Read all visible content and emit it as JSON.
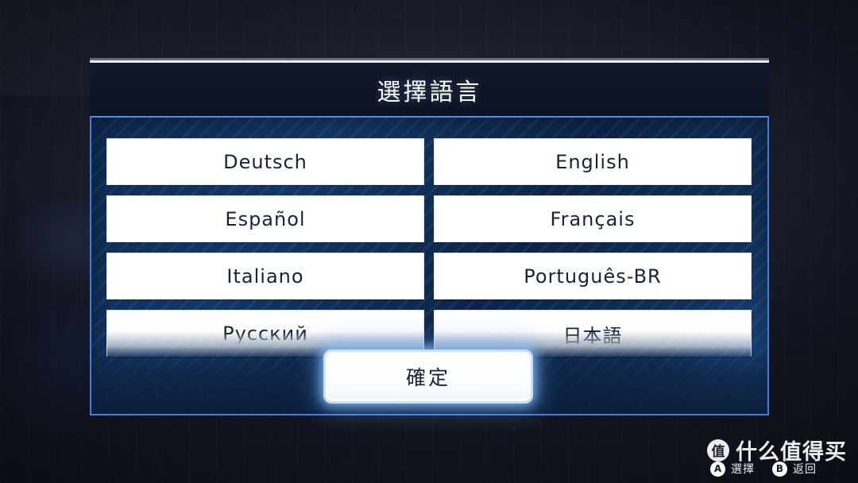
{
  "dialog": {
    "title": "選擇語言",
    "confirm_label": "確定"
  },
  "languages": [
    {
      "label": "Deutsch",
      "faded": false
    },
    {
      "label": "English",
      "faded": false
    },
    {
      "label": "Español",
      "faded": false
    },
    {
      "label": "Français",
      "faded": false
    },
    {
      "label": "Italiano",
      "faded": false
    },
    {
      "label": "Português-BR",
      "faded": false
    },
    {
      "label": "Русский",
      "faded": true
    },
    {
      "label": "日本語",
      "faded": true
    }
  ],
  "hints": [
    {
      "glyph": "A",
      "label": "選擇"
    },
    {
      "glyph": "B",
      "label": "返回"
    }
  ],
  "watermark": {
    "mark": "值",
    "text": "什么值得买"
  },
  "colors": {
    "accent_border": "#3b7fe0",
    "dialog_header_bg": "#0e1526",
    "button_bg": "#ffffff",
    "button_text": "#16233f",
    "title_text": "#ffffff"
  }
}
